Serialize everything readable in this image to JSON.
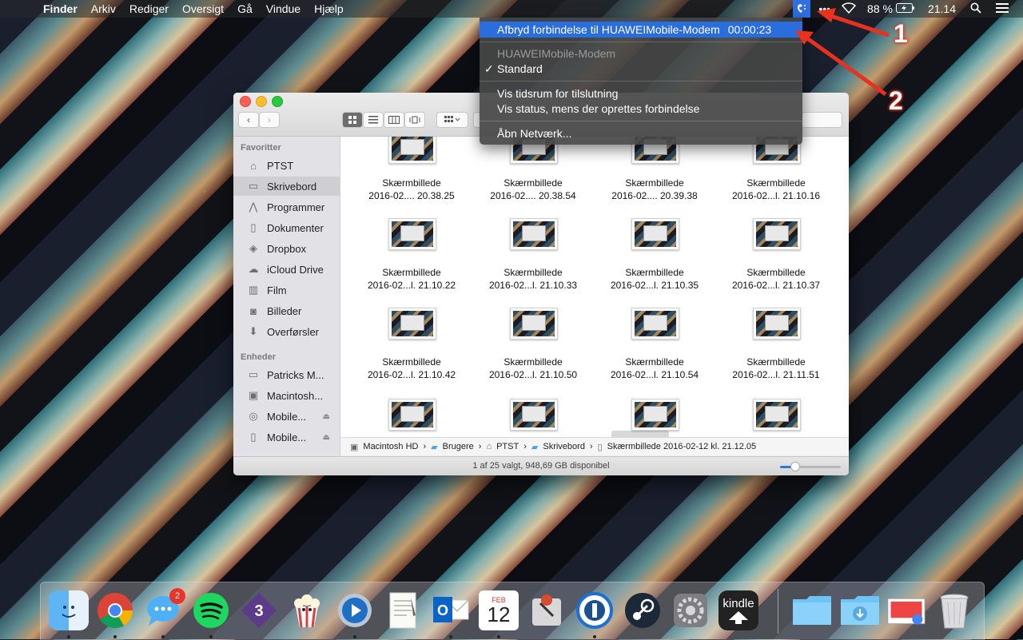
{
  "menubar": {
    "app": "Finder",
    "menus": [
      "Arkiv",
      "Rediger",
      "Oversigt",
      "Gå",
      "Vindue",
      "Hjælp"
    ],
    "battery": "88 %",
    "clock": "21.14"
  },
  "dropdown": {
    "disconnect": "Afbryd forbindelse til HUAWEIMobile-Modem",
    "timer": "00:00:23",
    "modem_name": "HUAWEIMobile-Modem",
    "standard": "Standard",
    "check": "✓",
    "show_time": "Vis tidsrum for tilslutning",
    "show_status": "Vis status, mens der oprettes forbindelse",
    "open_network": "Åbn Netværk..."
  },
  "annotations": [
    "1",
    "2"
  ],
  "sidebar": {
    "favorites_header": "Favoritter",
    "favorites": [
      {
        "label": "PTST",
        "icon": "home-icon"
      },
      {
        "label": "Skrivebord",
        "icon": "desktop-icon"
      },
      {
        "label": "Programmer",
        "icon": "applications-icon"
      },
      {
        "label": "Dokumenter",
        "icon": "document-icon"
      },
      {
        "label": "Dropbox",
        "icon": "dropbox-icon"
      },
      {
        "label": "iCloud Drive",
        "icon": "cloud-icon"
      },
      {
        "label": "Film",
        "icon": "film-icon"
      },
      {
        "label": "Billeder",
        "icon": "camera-icon"
      },
      {
        "label": "Overførsler",
        "icon": "download-icon"
      }
    ],
    "devices_header": "Enheder",
    "devices": [
      {
        "label": "Patricks M...",
        "icon": "laptop-icon"
      },
      {
        "label": "Macintosh...",
        "icon": "harddisk-icon"
      },
      {
        "label": "Mobile...",
        "icon": "disc-icon"
      },
      {
        "label": "Mobile...",
        "icon": "drive-icon"
      }
    ]
  },
  "files": [
    {
      "name": "Skærmbillede",
      "date": "2016-02.... 20.38.25"
    },
    {
      "name": "Skærmbillede",
      "date": "2016-02.... 20.38.54"
    },
    {
      "name": "Skærmbillede",
      "date": "2016-02.... 20.39.38"
    },
    {
      "name": "Skærmbillede",
      "date": "2016-02...l. 21.10.16"
    },
    {
      "name": "Skærmbillede",
      "date": "2016-02...l. 21.10.22"
    },
    {
      "name": "Skærmbillede",
      "date": "2016-02...l. 21.10.33"
    },
    {
      "name": "Skærmbillede",
      "date": "2016-02...l. 21.10.35"
    },
    {
      "name": "Skærmbillede",
      "date": "2016-02...l. 21.10.37"
    },
    {
      "name": "Skærmbillede",
      "date": "2016-02...l. 21.10.42"
    },
    {
      "name": "Skærmbillede",
      "date": "2016-02...l. 21.10.50"
    },
    {
      "name": "Skærmbillede",
      "date": "2016-02...l. 21.10.54"
    },
    {
      "name": "Skærmbillede",
      "date": "2016-02...l. 21.11.51"
    }
  ],
  "pathbar": [
    "Macintosh HD",
    "Brugere",
    "PTST",
    "Skrivebord",
    "Skærmbillede 2016-02-12 kl. 21.12.05"
  ],
  "status": "1 af 25 valgt, 948,69 GB disponibel",
  "icon_size_level": 0.25,
  "dock": {
    "messages_badge": "2",
    "calendar_month": "FEB",
    "calendar_day": "12",
    "kindle_label": "kindle",
    "apps": [
      "finder",
      "chrome",
      "messages",
      "spotify",
      "mail-3",
      "popcorn",
      "quicktime",
      "textedit",
      "outlook",
      "calendar",
      "git",
      "1password",
      "steam",
      "system-preferences",
      "kindle",
      "folder",
      "downloads",
      "screenshot",
      "trash"
    ]
  }
}
